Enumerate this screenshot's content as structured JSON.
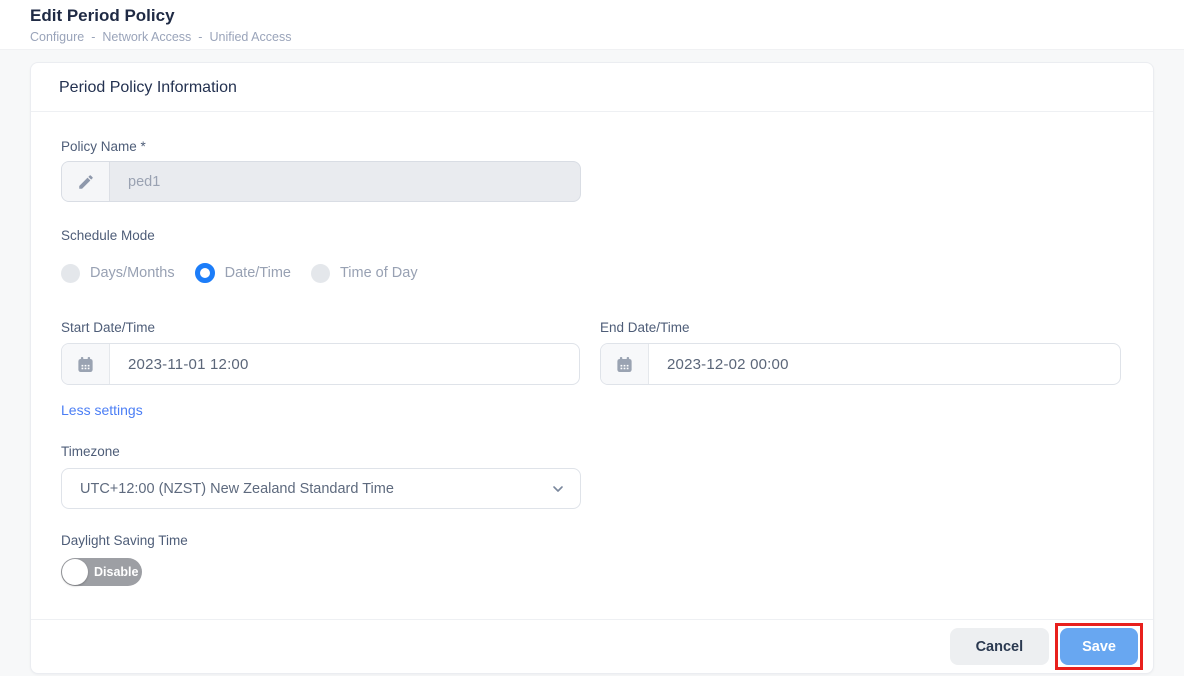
{
  "header": {
    "title": "Edit Period Policy",
    "breadcrumb": [
      "Configure",
      "Network Access",
      "Unified Access"
    ],
    "crumb_sep": "-"
  },
  "card": {
    "title": "Period Policy Information"
  },
  "form": {
    "policy_name": {
      "label": "Policy Name *",
      "value": "ped1",
      "icon": "pencil-icon"
    },
    "schedule_mode": {
      "label": "Schedule Mode",
      "options": [
        {
          "label": "Days/Months",
          "selected": false
        },
        {
          "label": "Date/Time",
          "selected": true
        },
        {
          "label": "Time of Day",
          "selected": false
        }
      ]
    },
    "start_datetime": {
      "label": "Start Date/Time",
      "value": "2023-11-01 12:00",
      "icon": "calendar-icon"
    },
    "end_datetime": {
      "label": "End Date/Time",
      "value": "2023-12-02 00:00",
      "icon": "calendar-icon"
    },
    "less_settings_link": "Less settings",
    "timezone": {
      "label": "Timezone",
      "value": "UTC+12:00 (NZST) New Zealand Standard Time"
    },
    "dst": {
      "label": "Daylight Saving Time",
      "state": "Disable",
      "enabled": false
    }
  },
  "footer": {
    "cancel_label": "Cancel",
    "save_label": "Save"
  },
  "colors": {
    "radio_selected_blue": "#1c7df9",
    "link_blue": "#4b7ef5",
    "save_blue": "#68a7f1",
    "annotation_red": "#e8201d",
    "toggle_gray": "#9d9fa4"
  }
}
